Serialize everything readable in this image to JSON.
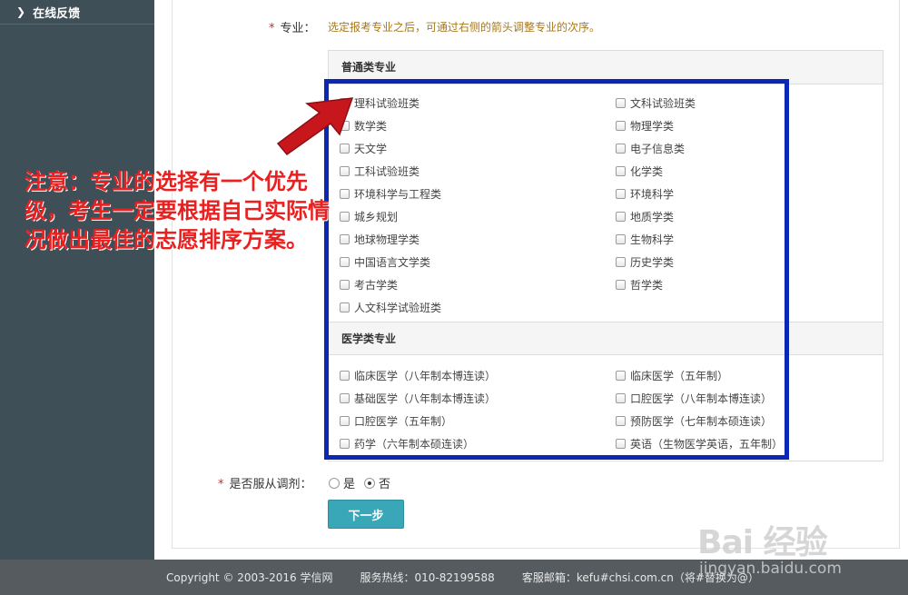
{
  "sidebar": {
    "items": [
      {
        "label": "在线反馈",
        "icon": "chevron-right-icon"
      }
    ]
  },
  "form": {
    "major_label": "专业：",
    "required_mark": "*",
    "major_hint": "选定报考专业之后，可通过右侧的箭头调整专业的次序。",
    "groups": [
      {
        "title": "普通类专业",
        "left": [
          "理科试验班类",
          "数学类",
          "天文学",
          "工科试验班类",
          "环境科学与工程类",
          "城乡规划",
          "地球物理学类",
          "中国语言文学类",
          "考古学类",
          "人文科学试验班类"
        ],
        "right": [
          "文科试验班类",
          "物理学类",
          "电子信息类",
          "化学类",
          "环境科学",
          "地质学类",
          "生物科学",
          "历史学类",
          "哲学类"
        ]
      },
      {
        "title": "医学类专业",
        "left": [
          "临床医学（八年制本博连读）",
          "基础医学（八年制本博连读）",
          "口腔医学（五年制）",
          "药学（六年制本硕连读）"
        ],
        "right": [
          "临床医学（五年制）",
          "口腔医学（八年制本博连读）",
          "预防医学（七年制本硕连读）",
          "英语（生物医学英语，五年制）"
        ]
      }
    ],
    "adjust_label": "是否服从调剂：",
    "adjust_options": [
      {
        "label": "是",
        "checked": false
      },
      {
        "label": "否",
        "checked": true
      }
    ],
    "next_button": "下一步"
  },
  "annotation": {
    "note": "注意：专业的选择有一个优先级，考生一定要根据自己实际情况做出最佳的志愿排序方案。",
    "box_color": "#0a28b4",
    "text_color": "#ea1f1f"
  },
  "footer": {
    "copyright": "Copyright © 2003-2016 学信网",
    "hotline": "服务热线：010-82199588",
    "email": "客服邮箱：kefu#chsi.com.cn（将#替换为@）"
  },
  "watermark": {
    "brand": "Bai 经验",
    "url": "jingyan.baidu.com"
  }
}
